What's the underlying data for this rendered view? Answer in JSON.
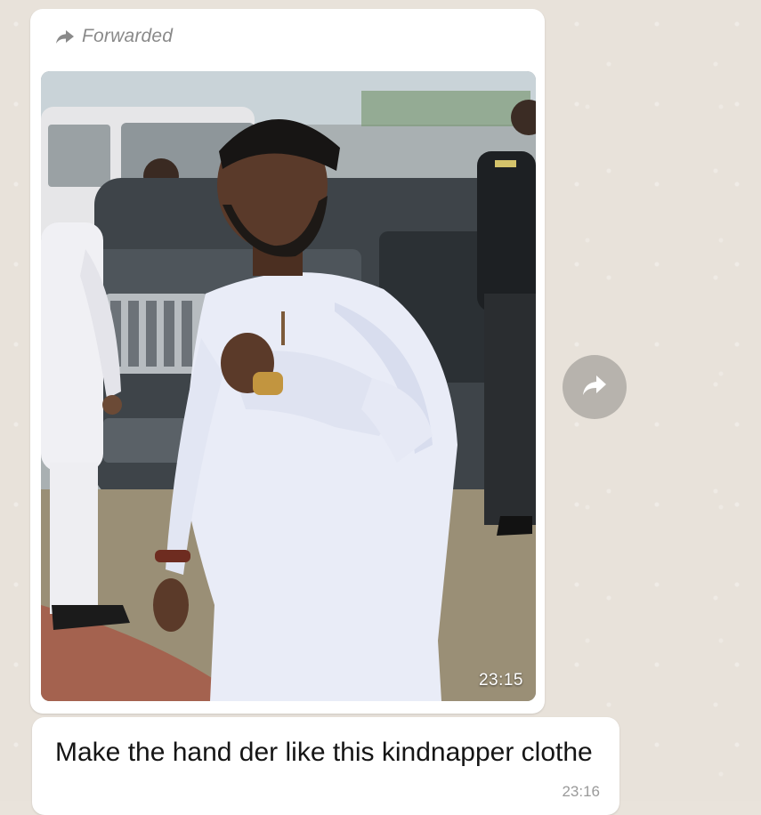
{
  "chat": {
    "image_message": {
      "forwarded_label": "Forwarded",
      "time": "23:15"
    },
    "text_message": {
      "text": "Make the hand der like this kindnapper clothe",
      "time": "23:16"
    }
  },
  "icons": {
    "forwarded": "forward-arrow-icon",
    "share": "share-arrow-icon"
  },
  "colors": {
    "bubble": "#ffffff",
    "wallpaper": "#e8e2da",
    "meta_text": "#8a8a8a",
    "share_button": "#b7b3ad"
  }
}
